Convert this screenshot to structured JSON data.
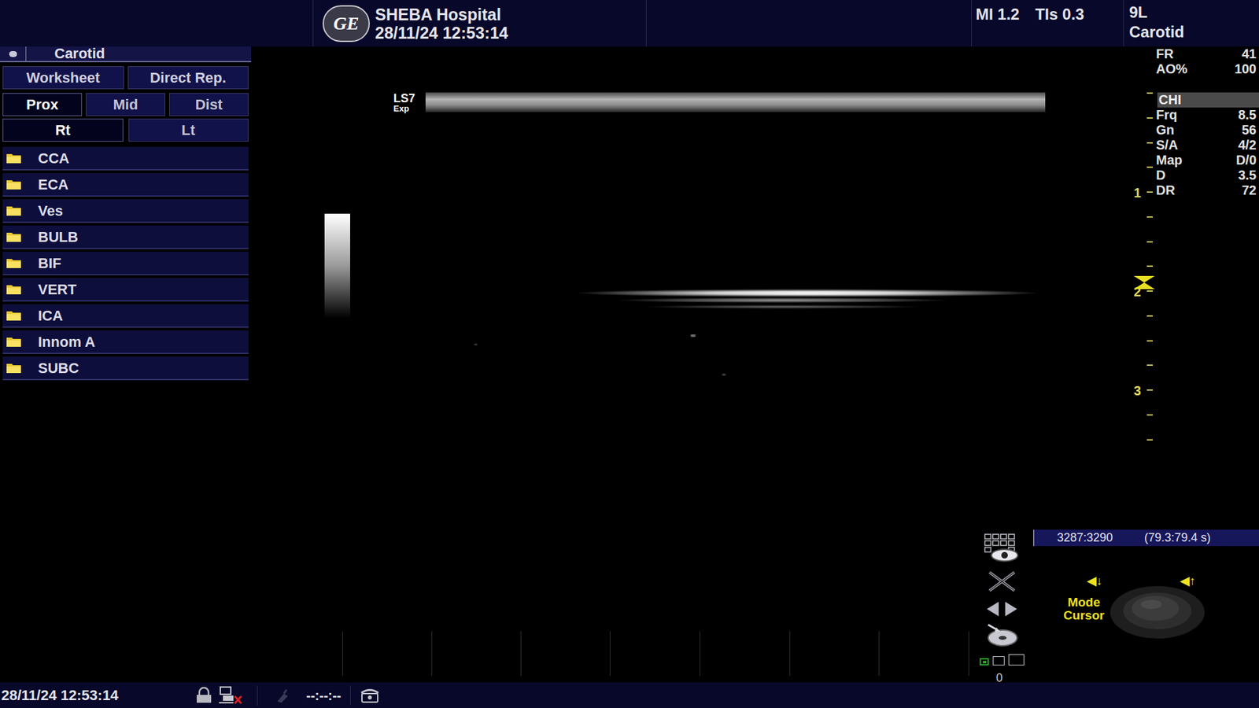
{
  "header": {
    "logo": "GE",
    "hospital": "SHEBA Hospital",
    "datetime": "28/11/24 12:53:14",
    "mi": "MI 1.2",
    "tis": "TIs 0.3",
    "probe": "9L",
    "preset": "Carotid"
  },
  "sidebar": {
    "title": "Carotid",
    "tabs": [
      {
        "label": "Worksheet",
        "selected": false
      },
      {
        "label": "Direct Rep.",
        "selected": false
      }
    ],
    "segments": [
      {
        "label": "Prox",
        "selected": true
      },
      {
        "label": "Mid",
        "selected": false
      },
      {
        "label": "Dist",
        "selected": false
      }
    ],
    "sides": [
      {
        "label": "Rt",
        "selected": true
      },
      {
        "label": "Lt",
        "selected": false
      }
    ],
    "items": [
      "CCA",
      "ECA",
      "Ves",
      "BULB",
      "BIF",
      "VERT",
      "ICA",
      "Innom A",
      "SUBC"
    ]
  },
  "image": {
    "probe_label": "LS7",
    "probe_mode": "Exp",
    "depth_labels": [
      "1",
      "2",
      "3"
    ]
  },
  "params": {
    "acquisition": [
      {
        "label": "FR",
        "value": "41"
      },
      {
        "label": "AO%",
        "value": "100"
      }
    ],
    "mode": {
      "label": "CHI",
      "selected": true
    },
    "rows": [
      {
        "label": "Frq",
        "value": "8.5"
      },
      {
        "label": "Gn",
        "value": "56"
      },
      {
        "label": "S/A",
        "value": "4/2"
      },
      {
        "label": "Map",
        "value": "D/0"
      },
      {
        "label": "D",
        "value": "3.5"
      },
      {
        "label": "DR",
        "value": "72"
      }
    ]
  },
  "cine": {
    "frames": "3287:3290",
    "time": "(79.3:79.4 s)"
  },
  "trackball": {
    "left_arrow": "◀↓",
    "right_arrow": "◀↑",
    "mode": "Mode",
    "cursor": "Cursor"
  },
  "counter": "0",
  "status_bar": {
    "datetime": "28/11/24 12:53:14",
    "clock": "--:--:--"
  }
}
